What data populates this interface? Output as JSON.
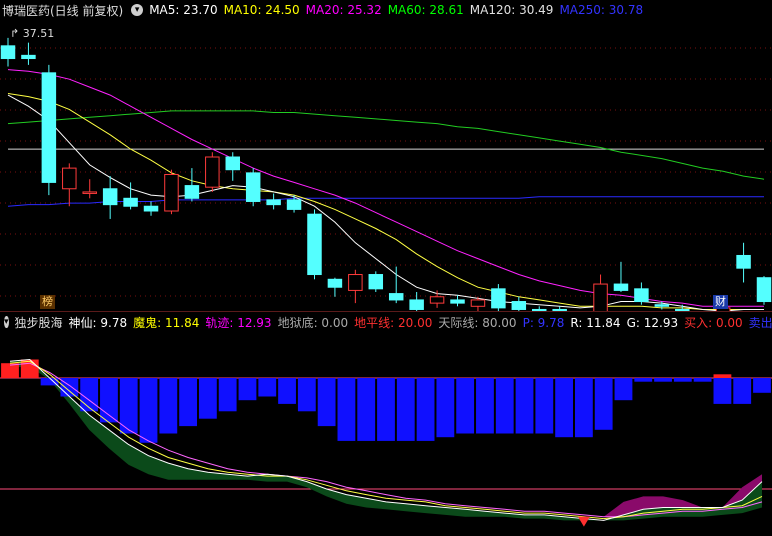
{
  "main_header": {
    "title": "博瑞医药(日线 前复权)",
    "ma": [
      {
        "label": "MA5: 23.70",
        "color": "#ffffff"
      },
      {
        "label": "MA10: 24.50",
        "color": "#ffff00"
      },
      {
        "label": "MA20: 25.32",
        "color": "#ff00ff"
      },
      {
        "label": "MA60: 28.61",
        "color": "#00ff00"
      },
      {
        "label": "MA120: 30.49",
        "color": "#e0e0e0"
      },
      {
        "label": "MA250: 30.78",
        "color": "#3333ff"
      }
    ]
  },
  "indicator_header": {
    "title": "独步股海",
    "items": [
      {
        "label": "神仙: 9.78",
        "color": "#ffffff"
      },
      {
        "label": "魔鬼: 11.84",
        "color": "#ffff00"
      },
      {
        "label": "轨迹: 12.93",
        "color": "#ff00ff"
      },
      {
        "label": "地狱底: 0.00",
        "color": "#aaaaaa"
      },
      {
        "label": "地平线: 20.00",
        "color": "#ff3030"
      },
      {
        "label": "天际线: 80.00",
        "color": "#aaaaaa"
      },
      {
        "label": "P: 9.78",
        "color": "#3333ff"
      },
      {
        "label": "R: 11.84",
        "color": "#ffffff"
      },
      {
        "label": "G: 12.93",
        "color": "#ffffff"
      },
      {
        "label": "买入: 0.00",
        "color": "#ff3030"
      },
      {
        "label": "卖出: 0.00",
        "color": "#3333ff"
      }
    ]
  },
  "tags": {
    "left": "榜",
    "right": "财"
  },
  "chart_data": [
    {
      "type": "candlestick",
      "price_label": "37.51",
      "ylim": [
        21.5,
        38.5
      ],
      "candles": [
        {
          "o": 37.0,
          "c": 36.2,
          "h": 37.5,
          "l": 35.7
        },
        {
          "o": 36.4,
          "c": 36.2,
          "h": 37.2,
          "l": 35.8
        },
        {
          "o": 35.3,
          "c": 28.4,
          "h": 35.8,
          "l": 27.6
        },
        {
          "o": 28.0,
          "c": 29.3,
          "h": 29.6,
          "l": 26.9
        },
        {
          "o": 27.8,
          "c": 27.8,
          "h": 28.6,
          "l": 27.4
        },
        {
          "o": 28.0,
          "c": 27.0,
          "h": 28.8,
          "l": 26.1
        },
        {
          "o": 27.4,
          "c": 26.9,
          "h": 28.4,
          "l": 26.7
        },
        {
          "o": 26.9,
          "c": 26.6,
          "h": 27.2,
          "l": 26.3
        },
        {
          "o": 26.6,
          "c": 28.9,
          "h": 29.2,
          "l": 26.4
        },
        {
          "o": 28.2,
          "c": 27.4,
          "h": 29.3,
          "l": 27.2
        },
        {
          "o": 28.1,
          "c": 30.0,
          "h": 30.3,
          "l": 27.8
        },
        {
          "o": 30.0,
          "c": 29.2,
          "h": 30.3,
          "l": 28.5
        },
        {
          "o": 29.0,
          "c": 27.2,
          "h": 29.3,
          "l": 26.9
        },
        {
          "o": 27.3,
          "c": 27.0,
          "h": 27.7,
          "l": 26.7
        },
        {
          "o": 27.3,
          "c": 26.7,
          "h": 27.6,
          "l": 26.5
        },
        {
          "o": 26.4,
          "c": 22.6,
          "h": 26.7,
          "l": 22.3
        },
        {
          "o": 22.3,
          "c": 21.8,
          "h": 22.4,
          "l": 21.2
        },
        {
          "o": 21.6,
          "c": 22.6,
          "h": 22.9,
          "l": 20.8
        },
        {
          "o": 22.6,
          "c": 21.7,
          "h": 22.8,
          "l": 21.5
        },
        {
          "o": 21.4,
          "c": 21.0,
          "h": 23.1,
          "l": 20.8
        },
        {
          "o": 21.0,
          "c": 20.4,
          "h": 21.5,
          "l": 20.2
        },
        {
          "o": 20.8,
          "c": 21.2,
          "h": 21.6,
          "l": 20.5
        },
        {
          "o": 21.0,
          "c": 20.8,
          "h": 21.3,
          "l": 20.6
        },
        {
          "o": 20.6,
          "c": 21.0,
          "h": 21.2,
          "l": 20.2
        },
        {
          "o": 21.7,
          "c": 20.5,
          "h": 22.0,
          "l": 20.3
        },
        {
          "o": 20.9,
          "c": 20.4,
          "h": 21.2,
          "l": 20.1
        },
        {
          "o": 20.4,
          "c": 20.3,
          "h": 20.6,
          "l": 20.1
        },
        {
          "o": 20.4,
          "c": 19.5,
          "h": 20.6,
          "l": 19.2
        },
        {
          "o": 19.2,
          "c": 19.8,
          "h": 20.0,
          "l": 19.0
        },
        {
          "o": 19.9,
          "c": 22.0,
          "h": 22.6,
          "l": 19.7
        },
        {
          "o": 22.0,
          "c": 21.6,
          "h": 23.4,
          "l": 21.5
        },
        {
          "o": 21.7,
          "c": 20.9,
          "h": 22.1,
          "l": 20.7
        },
        {
          "o": 20.7,
          "c": 20.6,
          "h": 20.9,
          "l": 20.4
        },
        {
          "o": 20.4,
          "c": 19.5,
          "h": 20.7,
          "l": 19.2
        },
        {
          "o": 19.6,
          "c": 19.6,
          "h": 19.8,
          "l": 19.4
        },
        {
          "o": 19.6,
          "c": 20.5,
          "h": 20.7,
          "l": 19.4
        },
        {
          "o": 23.8,
          "c": 23.0,
          "h": 24.6,
          "l": 22.1
        },
        {
          "o": 22.4,
          "c": 20.9,
          "h": 22.5,
          "l": 20.7
        }
      ],
      "ma": {
        "ma5": [
          33.9,
          33.2,
          32.3,
          30.9,
          29.5,
          28.7,
          28.0,
          27.6,
          27.5,
          27.6,
          27.9,
          28.2,
          28.1,
          27.8,
          27.5,
          26.9,
          25.9,
          24.6,
          23.6,
          22.6,
          21.8,
          21.4,
          21.3,
          21.1,
          20.9,
          20.8,
          20.7,
          20.6,
          20.5,
          20.6,
          20.9,
          20.9,
          20.8,
          20.6,
          20.4,
          20.3,
          20.4,
          20.4
        ],
        "ma10": [
          34.0,
          33.8,
          33.5,
          33.0,
          32.2,
          31.4,
          30.5,
          29.8,
          29.0,
          28.5,
          28.2,
          28.0,
          27.9,
          27.8,
          27.6,
          27.2,
          26.7,
          26.1,
          25.5,
          24.8,
          23.9,
          23.1,
          22.4,
          21.8,
          21.5,
          21.2,
          21.0,
          20.8,
          20.6,
          20.6,
          20.6,
          20.6,
          20.5,
          20.5,
          20.4,
          20.4,
          20.4,
          20.4
        ],
        "ma20": [
          35.5,
          35.4,
          35.2,
          34.9,
          34.4,
          33.9,
          33.2,
          32.5,
          31.8,
          31.1,
          30.5,
          29.9,
          29.3,
          28.8,
          28.4,
          28.0,
          27.6,
          27.1,
          26.5,
          25.9,
          25.3,
          24.7,
          24.1,
          23.6,
          23.1,
          22.6,
          22.2,
          21.9,
          21.6,
          21.4,
          21.3,
          21.1,
          20.9,
          20.8,
          20.6,
          20.6,
          20.6,
          20.6
        ],
        "ma60": [
          32.1,
          32.2,
          32.3,
          32.4,
          32.5,
          32.6,
          32.7,
          32.8,
          32.9,
          32.9,
          32.9,
          32.9,
          32.9,
          32.8,
          32.8,
          32.7,
          32.6,
          32.5,
          32.4,
          32.3,
          32.2,
          32.1,
          31.9,
          31.8,
          31.6,
          31.4,
          31.2,
          31.0,
          30.8,
          30.6,
          30.3,
          30.1,
          29.9,
          29.6,
          29.3,
          29.1,
          28.8,
          28.6
        ],
        "ma120": [
          30.5,
          30.5,
          30.5,
          30.5,
          30.5,
          30.5,
          30.5,
          30.5,
          30.5,
          30.5,
          30.5,
          30.5,
          30.5,
          30.5,
          30.5,
          30.5,
          30.5,
          30.5,
          30.5,
          30.5,
          30.5,
          30.5,
          30.5,
          30.5,
          30.5,
          30.5,
          30.5,
          30.5,
          30.5,
          30.5,
          30.5,
          30.5,
          30.5,
          30.5,
          30.5,
          30.5,
          30.5,
          30.5
        ],
        "ma250": [
          26.9,
          27.0,
          27.0,
          27.1,
          27.1,
          27.2,
          27.2,
          27.2,
          27.3,
          27.3,
          27.3,
          27.3,
          27.3,
          27.3,
          27.4,
          27.4,
          27.4,
          27.4,
          27.4,
          27.4,
          27.4,
          27.4,
          27.4,
          27.4,
          27.4,
          27.4,
          27.5,
          27.5,
          27.5,
          27.5,
          27.5,
          27.5,
          27.5,
          27.5,
          27.5,
          27.5,
          27.5,
          27.5
        ]
      }
    },
    {
      "type": "bar_line",
      "ylim": [
        0,
        100
      ],
      "levels": [
        20,
        80
      ],
      "blue_bars": [
        0,
        0,
        4,
        10,
        18,
        24,
        30,
        35,
        30,
        26,
        22,
        18,
        12,
        10,
        14,
        18,
        26,
        34,
        34,
        34,
        34,
        34,
        32,
        30,
        30,
        30,
        30,
        30,
        32,
        32,
        28,
        12,
        2,
        2,
        2,
        2,
        14,
        14,
        8
      ],
      "top_blocks": [
        {
          "i": 0,
          "value": 8,
          "color": "#ff2020"
        },
        {
          "i": 1,
          "value": 10,
          "color": "#ff2020"
        },
        {
          "i": 36,
          "value": 2,
          "color": "#ff2020"
        }
      ],
      "lines": {
        "shenxian": [
          89,
          90,
          80,
          70,
          60,
          52,
          44,
          38,
          34,
          31,
          29,
          28,
          27,
          28,
          27,
          24,
          20,
          17,
          15,
          13,
          12,
          11,
          10,
          9,
          8,
          7,
          6,
          6,
          5,
          4,
          3,
          6,
          9,
          10,
          10,
          10,
          10,
          14,
          24
        ],
        "mogui": [
          88,
          89,
          82,
          73,
          64,
          56,
          48,
          42,
          37,
          34,
          31,
          29,
          28,
          27,
          27,
          25,
          22,
          19,
          17,
          15,
          14,
          13,
          11,
          10,
          9,
          8,
          7,
          7,
          6,
          5,
          4,
          5,
          7,
          8,
          9,
          9,
          10,
          11,
          16
        ],
        "guiji": [
          87,
          88,
          83,
          76,
          68,
          60,
          52,
          46,
          41,
          37,
          34,
          31,
          29,
          28,
          27,
          26,
          24,
          21,
          19,
          17,
          15,
          14,
          12,
          11,
          10,
          9,
          8,
          8,
          7,
          6,
          5,
          5,
          6,
          7,
          8,
          8,
          9,
          10,
          13
        ],
        "green_fill": [
          86,
          86,
          79,
          66,
          52,
          42,
          33,
          28,
          25,
          25,
          25,
          25,
          25,
          24,
          24,
          21,
          16,
          12,
          10,
          9,
          8,
          7,
          6,
          5,
          5,
          5,
          4,
          4,
          3,
          3,
          3,
          3,
          4,
          5,
          5,
          5,
          6,
          7,
          10
        ],
        "purple_fill": [
          87,
          88,
          83,
          76,
          68,
          60,
          52,
          46,
          41,
          37,
          34,
          31,
          29,
          28,
          27,
          26,
          24,
          21,
          19,
          17,
          15,
          14,
          12,
          11,
          10,
          9,
          8,
          8,
          7,
          6,
          5,
          13,
          16,
          16,
          14,
          10,
          10,
          21,
          28
        ]
      }
    }
  ]
}
